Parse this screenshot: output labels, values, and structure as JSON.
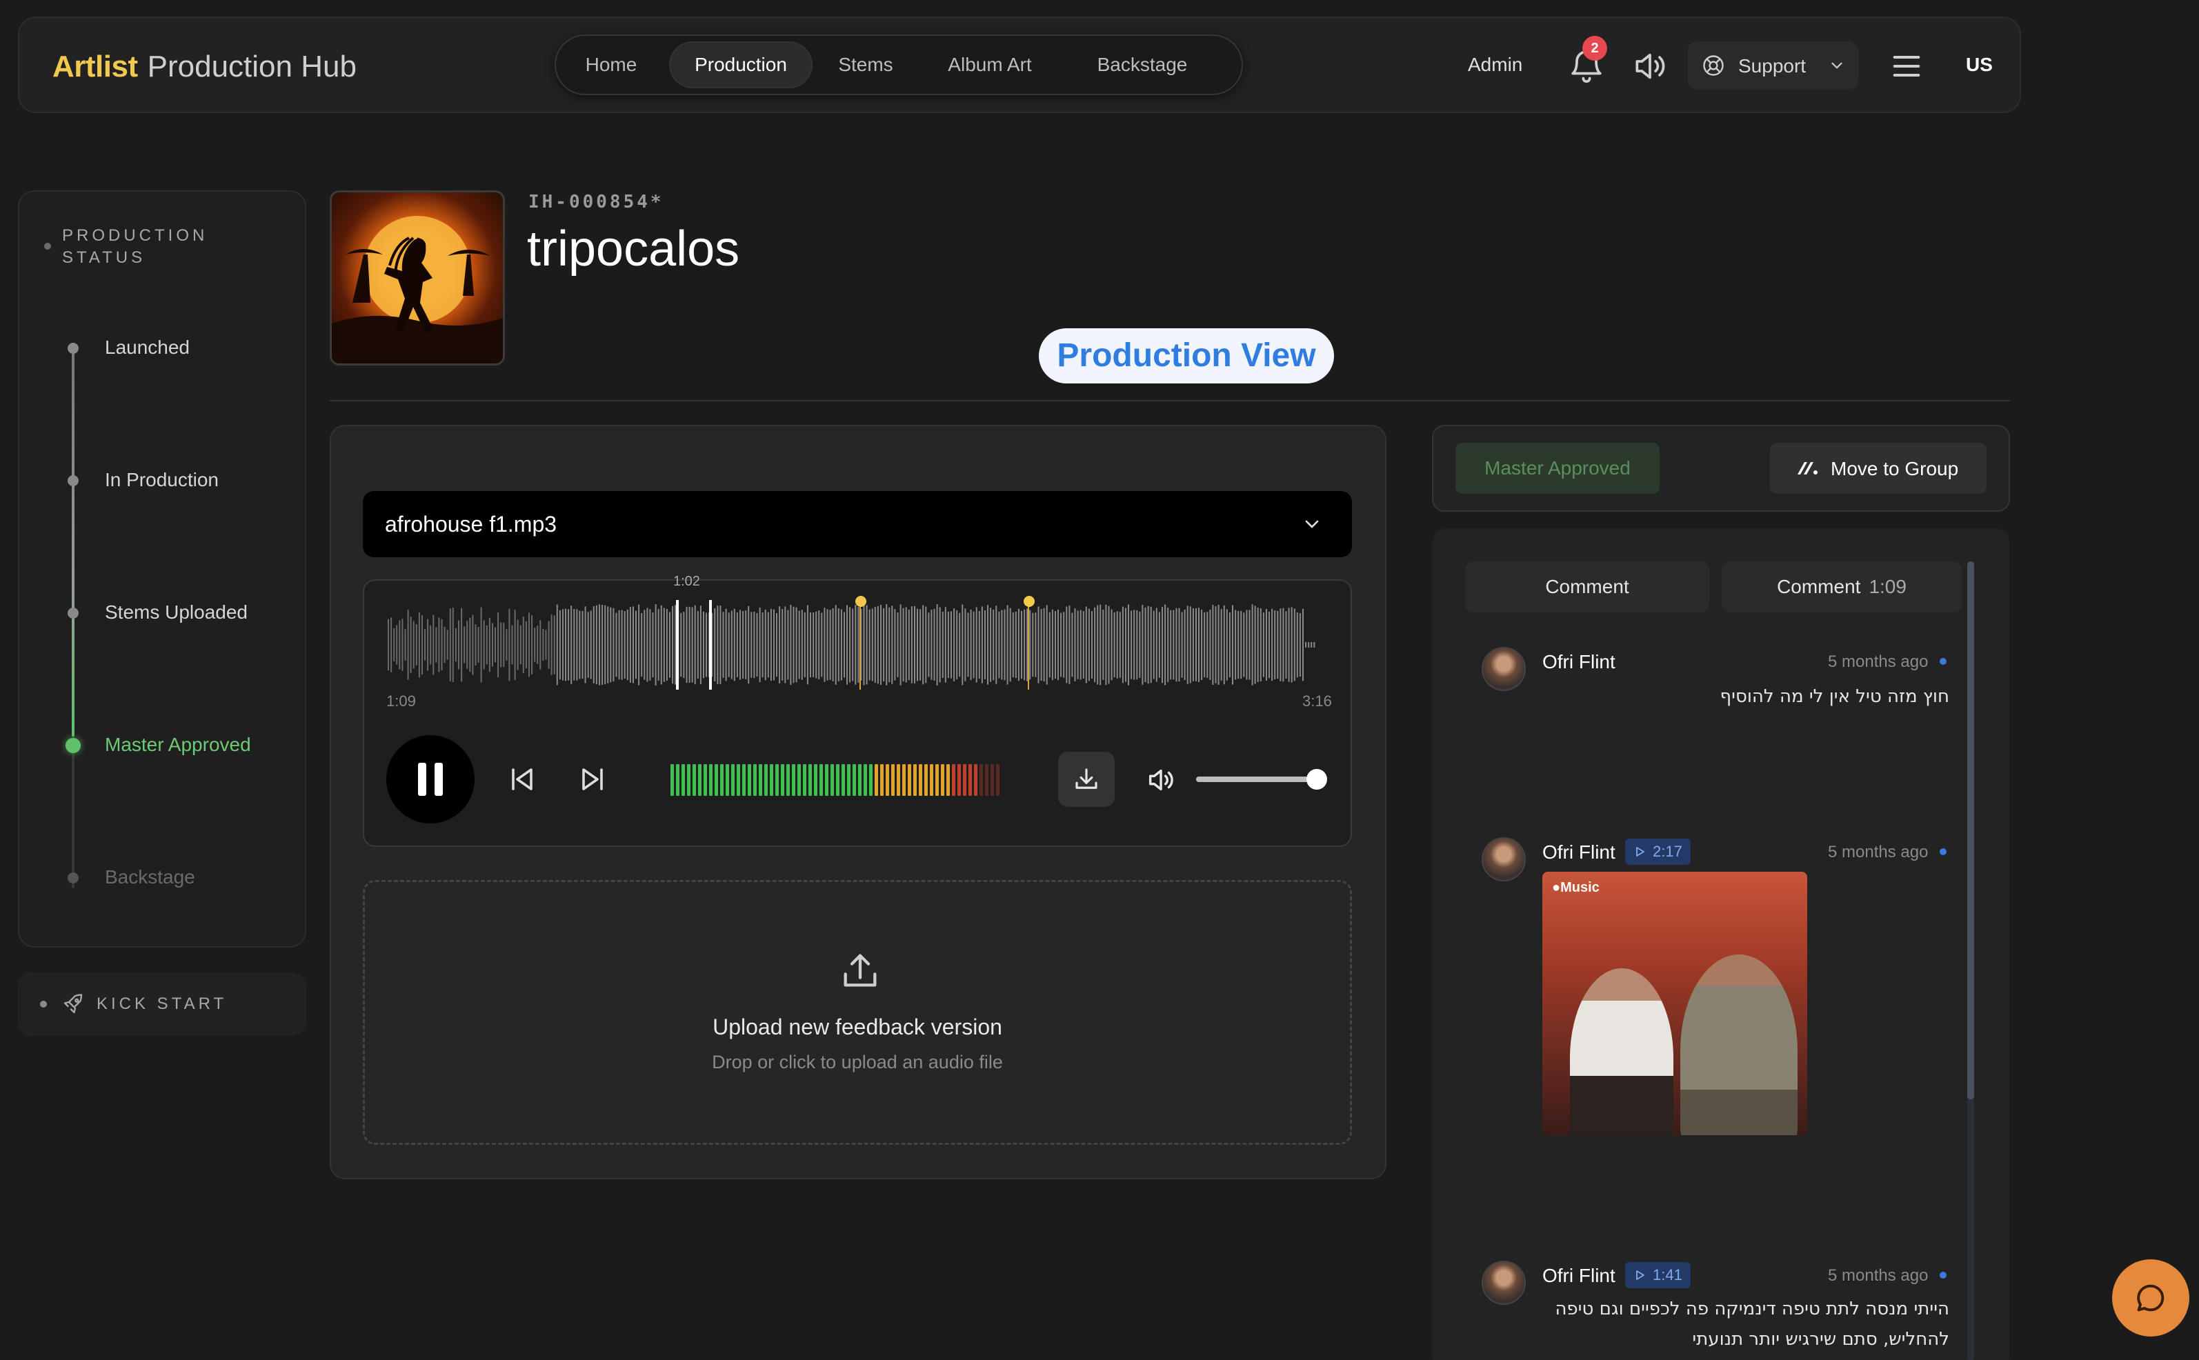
{
  "app": {
    "brand": "Artlist",
    "product": "Production Hub"
  },
  "nav": {
    "tabs": [
      "Home",
      "Production",
      "Stems",
      "Album Art",
      "Backstage"
    ],
    "active": "Production"
  },
  "header_right": {
    "admin": "Admin",
    "notifications": "2",
    "support": "Support",
    "locale": "US"
  },
  "sidebar": {
    "title": "PRODUCTION STATUS",
    "steps": [
      "Launched",
      "In Production",
      "Stems Uploaded",
      "Master Approved",
      "Backstage"
    ],
    "active_step": "Master Approved",
    "kickstart": "KICK START"
  },
  "track": {
    "catalog_no": "IH-000854*",
    "title": "tripocalos",
    "view_label": "Production View"
  },
  "player": {
    "file": "afrohouse f1.mp3",
    "current_time": "1:02",
    "start_time": "1:09",
    "end_time": "3:16",
    "volume": 0.9,
    "upload_title": "Upload new feedback version",
    "upload_hint": "Drop or click to upload an audio file"
  },
  "status_panel": {
    "status": "Master Approved",
    "move_button": "Move to Group"
  },
  "comment_tabs": {
    "comment": "Comment",
    "comment_at": "Comment",
    "comment_time": "1:09"
  },
  "comments": [
    {
      "author": "Ofri Flint",
      "ago": "5 months ago",
      "text": "חוץ מזה טיל אין לי מה להוסיף"
    },
    {
      "author": "Ofri Flint",
      "timestamp": "2:17",
      "ago": "5 months ago",
      "media_label": "Music"
    },
    {
      "author": "Ofri Flint",
      "timestamp": "1:41",
      "ago": "5 months ago",
      "text_line1": "הייתי מנסה לתת טיפה דינמיקה פה לכפיים וגם טיפה",
      "text_line2": "להחליש, סתם שירגיש יותר תנועתי"
    }
  ],
  "colors": {
    "accent_brand": "#f2c94c",
    "approved_green": "#6ccb73",
    "view_blue": "#2f7de1",
    "chat_orange": "#e58a3c"
  }
}
